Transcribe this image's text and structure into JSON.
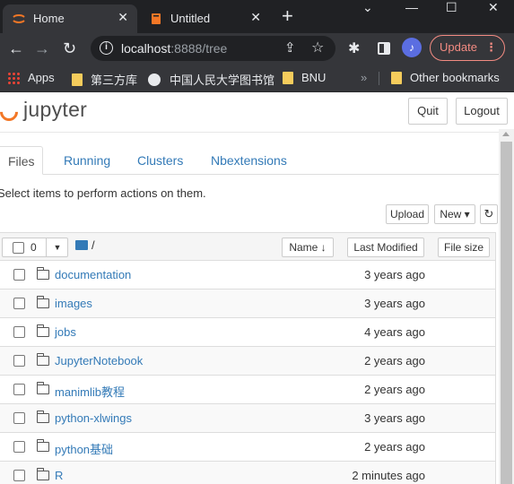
{
  "browser": {
    "tabs": [
      {
        "title": "Home",
        "close": "✕"
      },
      {
        "title": "Untitled",
        "close": "✕"
      }
    ],
    "new_tab": "+",
    "window_controls": {
      "minimize": "—",
      "maximize": "☐",
      "close": "✕"
    },
    "url_host": "localhost",
    "url_rest": ":8888/tree",
    "update_label": "Update",
    "bookmarks": [
      "Apps",
      "第三方库",
      "中国人民大学图书馆",
      "BNU"
    ],
    "other_bookmarks": "Other bookmarks",
    "overflow": "»"
  },
  "header": {
    "logo_text": "jupyter",
    "quit_label": "Quit",
    "logout_label": "Logout"
  },
  "tabs": [
    "Files",
    "Running",
    "Clusters",
    "Nbextensions"
  ],
  "hint": "Select items to perform actions on them.",
  "actions": {
    "upload": "Upload",
    "new": "New ▾",
    "refresh": "↻"
  },
  "list_header": {
    "selected_count": "0",
    "path": "/",
    "name_sort": "Name ↓",
    "last_modified": "Last Modified",
    "file_size": "File size"
  },
  "files": [
    {
      "name": "documentation",
      "modified": "3 years ago"
    },
    {
      "name": "images",
      "modified": "3 years ago"
    },
    {
      "name": "jobs",
      "modified": "4 years ago"
    },
    {
      "name": "JupyterNotebook",
      "modified": "2 years ago"
    },
    {
      "name": "manimlib教程",
      "modified": "2 years ago"
    },
    {
      "name": "python-xlwings",
      "modified": "3 years ago"
    },
    {
      "name": "python基础",
      "modified": "2 years ago"
    },
    {
      "name": "R",
      "modified": "2 minutes ago"
    }
  ],
  "colors": {
    "accent": "#337ab7",
    "jupyter_orange": "#f37726",
    "chrome_dark": "#202124"
  }
}
